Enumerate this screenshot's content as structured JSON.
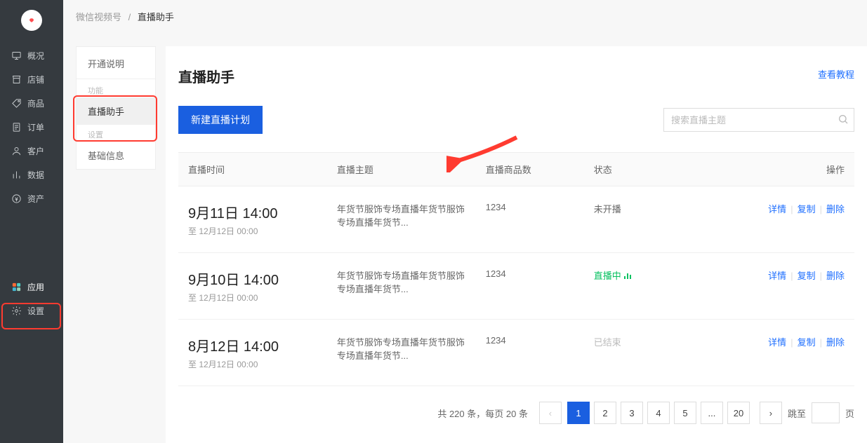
{
  "breadcrumb": {
    "root": "微信视频号",
    "current": "直播助手",
    "sep": "/"
  },
  "nav": {
    "items": [
      {
        "label": "概况"
      },
      {
        "label": "店铺"
      },
      {
        "label": "商品"
      },
      {
        "label": "订单"
      },
      {
        "label": "客户"
      },
      {
        "label": "数据"
      },
      {
        "label": "资产"
      }
    ],
    "apps": "应用",
    "settings": "设置"
  },
  "subnav": {
    "open_guide": "开通说明",
    "section_feature": "功能",
    "live_assistant": "直播助手",
    "section_settings": "设置",
    "basic_info": "基础信息"
  },
  "header": {
    "title": "直播助手",
    "tutorial": "查看教程"
  },
  "toolbar": {
    "create_plan": "新建直播计划",
    "search_placeholder": "搜索直播主题"
  },
  "table": {
    "cols": {
      "time": "直播时间",
      "topic": "直播主题",
      "goods": "直播商品数",
      "status": "状态",
      "ops": "操作"
    },
    "ops": {
      "detail": "详情",
      "copy": "复制",
      "delete": "删除"
    },
    "rows": [
      {
        "time_main": "9月11日 14:00",
        "time_sub": "至 12月12日 00:00",
        "topic": "年货节服饰专场直播年货节服饰专场直播年货节...",
        "goods": "1234",
        "status_key": "not_started",
        "status_text": "未开播"
      },
      {
        "time_main": "9月10日 14:00",
        "time_sub": "至 12月12日 00:00",
        "topic": "年货节服饰专场直播年货节服饰专场直播年货节...",
        "goods": "1234",
        "status_key": "live",
        "status_text": "直播中"
      },
      {
        "time_main": "8月12日 14:00",
        "time_sub": "至 12月12日 00:00",
        "topic": "年货节服饰专场直播年货节服饰专场直播年货节...",
        "goods": "1234",
        "status_key": "ended",
        "status_text": "已结束"
      }
    ]
  },
  "pagination": {
    "summary_prefix": "共 ",
    "total": "220",
    "summary_mid": " 条，每页 ",
    "per_page": "20",
    "summary_suffix": " 条",
    "pages": [
      "1",
      "2",
      "3",
      "4",
      "5",
      "...",
      "20"
    ],
    "active": "1",
    "jump_label": "跳至",
    "jump_unit": "页"
  }
}
